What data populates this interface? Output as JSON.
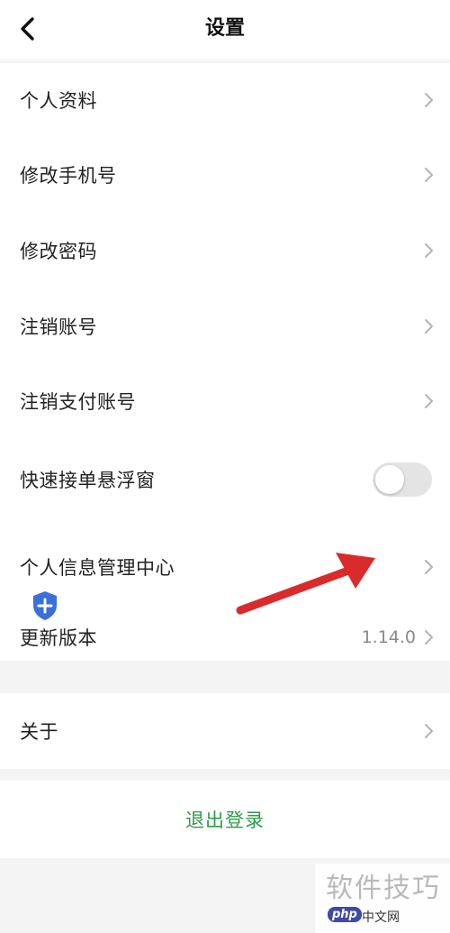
{
  "header": {
    "title": "设置",
    "back_icon": "chevron-left-icon"
  },
  "settings": {
    "profile": "个人资料",
    "change_phone": "修改手机号",
    "change_password": "修改密码",
    "cancel_account": "注销账号",
    "cancel_payment_account": "注销支付账号",
    "floating_window": "快速接单悬浮窗",
    "floating_window_enabled": false,
    "privacy_center": "个人信息管理中心",
    "update_version": "更新版本",
    "version_value": "1.14.0",
    "about": "关于"
  },
  "logout": {
    "label": "退出登录"
  },
  "watermark": {
    "text": "软件技巧",
    "logo": "php",
    "site": "中文网"
  },
  "colors": {
    "logout_text": "#2e9b4b",
    "background": "#f4f4f4",
    "toggle_off": "#e4e4e4",
    "shield_badge": "#3a6fdc",
    "annotation_arrow": "#d92b2b"
  }
}
